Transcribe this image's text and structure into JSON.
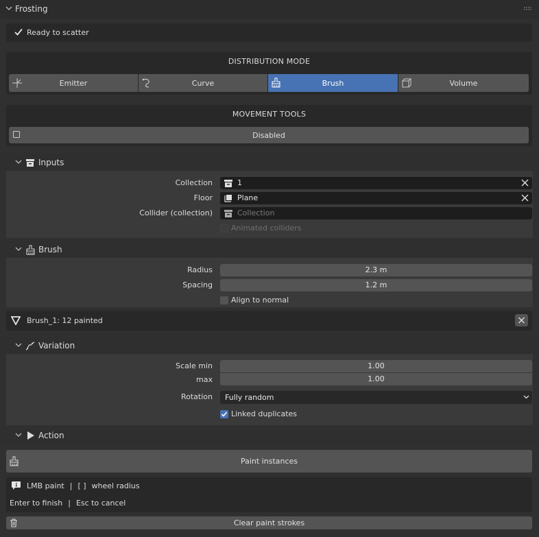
{
  "header": {
    "title": "Frosting"
  },
  "status": {
    "text": "Ready to scatter"
  },
  "distribution": {
    "heading": "DISTRIBUTION MODE",
    "modes": [
      {
        "label": "Emitter",
        "icon": "emitter-icon"
      },
      {
        "label": "Curve",
        "icon": "curve-icon"
      },
      {
        "label": "Brush",
        "icon": "brush-icon",
        "active": true
      },
      {
        "label": "Volume",
        "icon": "volume-icon"
      }
    ]
  },
  "movement": {
    "heading": "MOVEMENT TOOLS",
    "button_label": "Disabled"
  },
  "inputs": {
    "title": "Inputs",
    "collection_label": "Collection",
    "collection_value": "1",
    "floor_label": "Floor",
    "floor_value": "Plane",
    "collider_label": "Collider (collection)",
    "collider_placeholder": "Collection",
    "animated_label": "Animated colliders"
  },
  "brush": {
    "title": "Brush",
    "radius_label": "Radius",
    "radius_value": "2.3 m",
    "spacing_label": "Spacing",
    "spacing_value": "1.2 m",
    "align_label": "Align to normal",
    "entry_text": "Brush_1: 12 painted"
  },
  "variation": {
    "title": "Variation",
    "scale_min_label": "Scale min",
    "scale_min_value": "1.00",
    "scale_max_label": "max",
    "scale_max_value": "1.00",
    "rotation_label": "Rotation",
    "rotation_value": "Fully random",
    "linked_label": "Linked duplicates",
    "linked_checked": true
  },
  "action": {
    "title": "Action",
    "paint_label": "Paint instances",
    "hint_lmb": "LMB paint",
    "hint_sep": "|",
    "hint_brackets": "[ ]",
    "hint_wheel": "wheel radius",
    "hint_enter": "Enter to finish",
    "hint_esc": "Esc to cancel",
    "clear_label": "Clear paint strokes"
  },
  "colors": {
    "accent": "#4772b3",
    "panel": "#303030",
    "button": "#545454"
  }
}
